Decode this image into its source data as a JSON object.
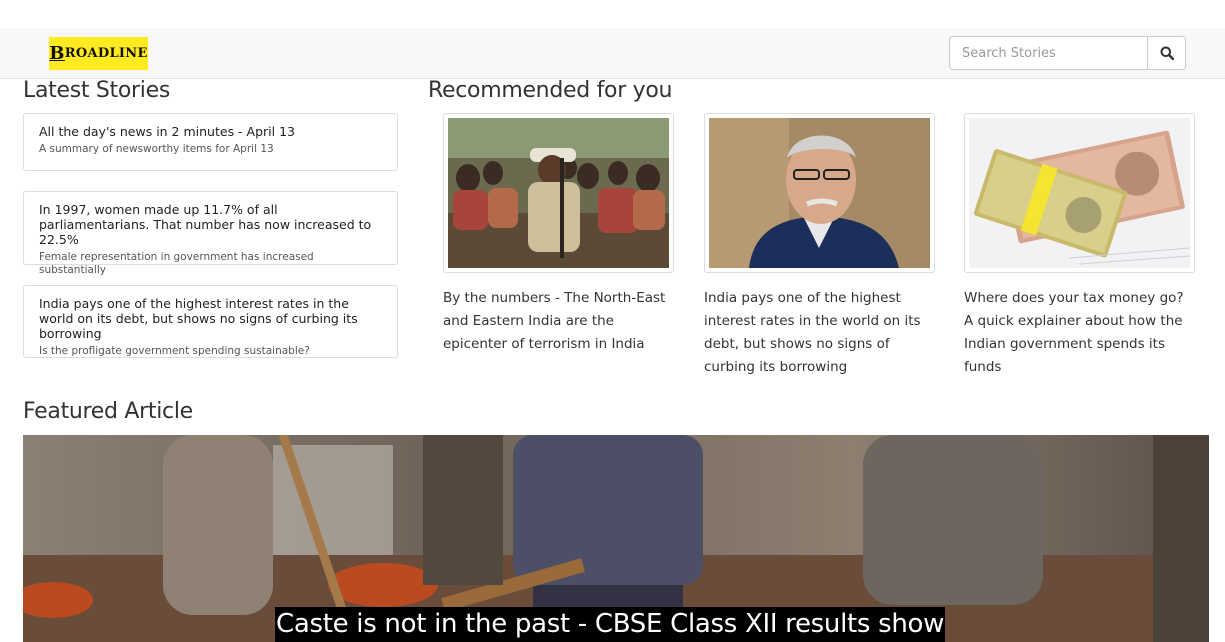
{
  "header": {
    "logo_text": "BROADLINE",
    "search_placeholder": "Search Stories",
    "search_icon": "magnifier-icon"
  },
  "latest": {
    "heading": "Latest Stories",
    "items": [
      {
        "title": "All the day's news in 2 minutes - April 13",
        "summary": "A summary of newsworthy items for April 13"
      },
      {
        "title": "In 1997, women made up 11.7% of all parliamentarians. That number has now increased to 22.5%",
        "summary": "Female representation in government has increased substantially"
      },
      {
        "title": "India pays one of the highest interest rates in the world on its debt, but shows no signs of curbing its borrowing",
        "summary": "Is the profligate government spending sustainable?"
      }
    ]
  },
  "recommended": {
    "heading": "Recommended for you",
    "cards": [
      {
        "caption": "By the numbers - The North-East and Eastern India are the epicenter of terrorism in India",
        "image": "crowd-photo"
      },
      {
        "caption": "India pays one of the highest interest rates in the world on its debt, but shows no signs of curbing its borrowing",
        "image": "minister-portrait-photo"
      },
      {
        "caption": "Where does your tax money go? A quick explainer about how the Indian government spends its funds",
        "image": "currency-bundles-photo"
      }
    ]
  },
  "featured": {
    "heading": "Featured Article",
    "title": "Caste is not in the past - CBSE Class XII results show",
    "image": "child-labourers-photo"
  },
  "colors": {
    "logo_bg": "#ffeb1f",
    "navbar_bg": "#f8f8f8",
    "border": "#dddddd"
  }
}
